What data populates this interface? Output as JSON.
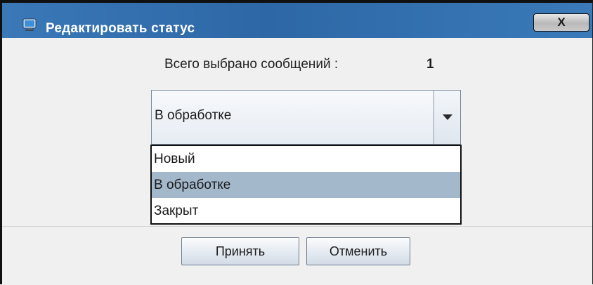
{
  "window": {
    "title": "Редактировать статус",
    "close_label": "X"
  },
  "summary": {
    "label": "Всего выбрано сообщений :",
    "value": "1"
  },
  "status_select": {
    "selected": "В обработке",
    "options": [
      "Новый",
      "В обработке",
      "Закрыт"
    ],
    "highlighted_index": 1
  },
  "buttons": {
    "accept_label": "Принять",
    "cancel_label": "Отменить"
  },
  "colors": {
    "titlebar": "#2d67a6",
    "highlight": "#a4b8cc",
    "panel": "#f0f0f0"
  }
}
